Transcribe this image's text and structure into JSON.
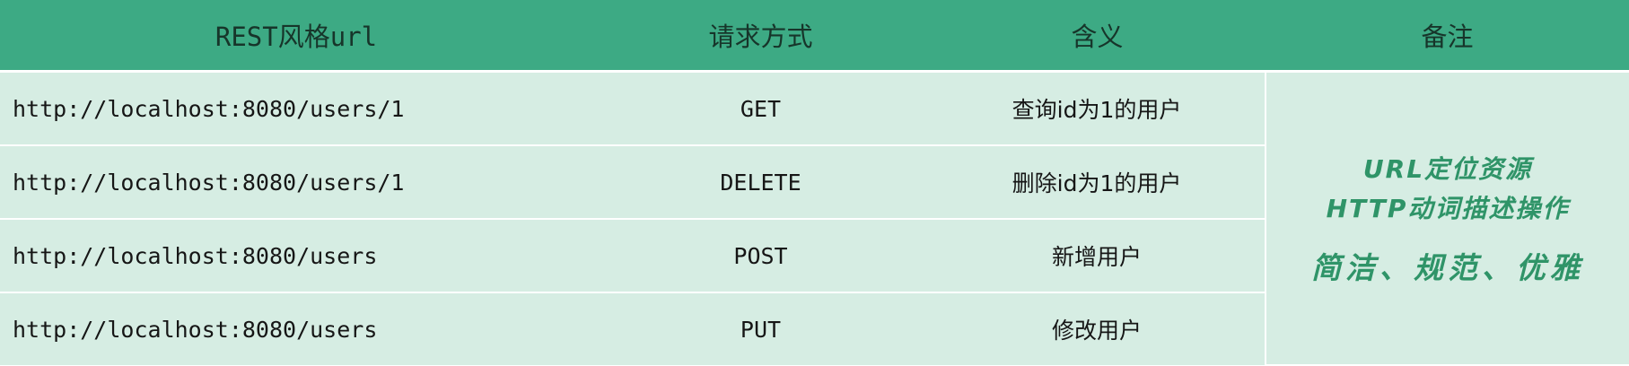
{
  "headers": {
    "url": "REST风格url",
    "method": "请求方式",
    "meaning": "含义",
    "note": "备注"
  },
  "rows": [
    {
      "url": "http://localhost:8080/users/1",
      "method": "GET",
      "meaning": "查询id为1的用户"
    },
    {
      "url": "http://localhost:8080/users/1",
      "method": "DELETE",
      "meaning": "删除id为1的用户"
    },
    {
      "url": "http://localhost:8080/users",
      "method": "POST",
      "meaning": "新增用户"
    },
    {
      "url": "http://localhost:8080/users",
      "method": "PUT",
      "meaning": "修改用户"
    }
  ],
  "note": {
    "line1": "URL定位资源",
    "line2": "HTTP动词描述操作",
    "line3": "简洁、规范、优雅"
  },
  "colors": {
    "header_bg": "#3daa84",
    "row_bg": "#d6ede3",
    "note_text": "#2f9468"
  }
}
